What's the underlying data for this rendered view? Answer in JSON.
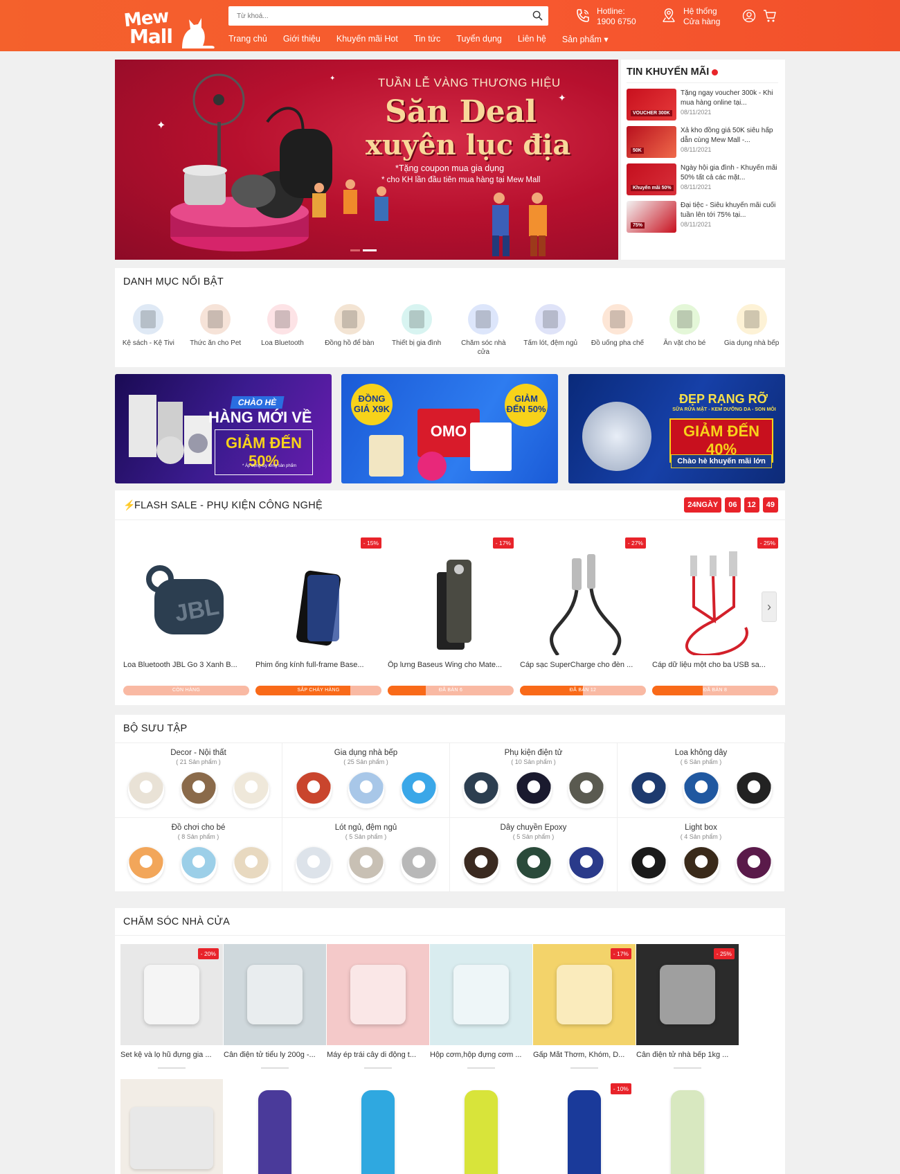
{
  "header": {
    "logo_line1": "Mew",
    "logo_line2": "Mall",
    "search_placeholder": "Từ khoá...",
    "hotline_label": "Hotline:",
    "hotline_number": "1900 6750",
    "store_line1": "Hệ thống",
    "store_line2": "Cửa hàng"
  },
  "nav": [
    "Trang chủ",
    "Giới thiệu",
    "Khuyến mãi Hot",
    "Tin tức",
    "Tuyển dụng",
    "Liên hệ",
    "Sản phẩm ▾"
  ],
  "banner": {
    "line1": "TUẦN LỄ VÀNG THƯƠNG HIỆU",
    "line2": "Săn Deal",
    "line3": "xuyên lục địa",
    "line4": "*Tặng coupon mua gia dụng",
    "line5": "* cho KH lần đầu tiên mua hàng tại Mew Mall"
  },
  "news": {
    "title": "TIN KHUYẾN MÃI",
    "items": [
      {
        "text": "Tặng ngay voucher 300k - Khi mua hàng online tại...",
        "date": "08/11/2021",
        "badge": "VOUCHER 300K"
      },
      {
        "text": "Xả kho đồng giá 50K siêu hấp dẫn cùng Mew Mall -...",
        "date": "08/11/2021",
        "badge": "50K"
      },
      {
        "text": "Ngày hội gia đình - Khuyến mãi 50% tất cả các mặt...",
        "date": "08/11/2021",
        "badge": "Khuyến mãi 50%"
      },
      {
        "text": "Đại tiệc - Siêu khuyến mãi cuối tuần lên tới 75% tại...",
        "date": "08/11/2021",
        "badge": "75%"
      }
    ]
  },
  "categories": {
    "title": "DANH MỤC NỔI BẬT",
    "items": [
      {
        "label": "Kệ sách - Kệ Tivi",
        "color": "#dfe9f5"
      },
      {
        "label": "Thức ăn cho Pet",
        "color": "#f6e3d8"
      },
      {
        "label": "Loa Bluetooth",
        "color": "#fde3e6"
      },
      {
        "label": "Đồng hồ để bàn",
        "color": "#f3e4d3"
      },
      {
        "label": "Thiết bị gia đình",
        "color": "#d8f4f1"
      },
      {
        "label": "Chăm sóc nhà cửa",
        "color": "#dde6fb"
      },
      {
        "label": "Tấm lót, đệm ngủ",
        "color": "#dfe3f8"
      },
      {
        "label": "Đồ uống pha chế",
        "color": "#fde6d6"
      },
      {
        "label": "Ăn vặt cho bé",
        "color": "#e4f7d8"
      },
      {
        "label": "Gia dụng nhà bếp",
        "color": "#fdf2d6"
      }
    ]
  },
  "promos": [
    {
      "line1": "CHÀO HÈ",
      "line2": "HÀNG MỚI VỀ",
      "line3": "GIẢM ĐẾN 50%",
      "note": "* Áp dụng tùy từng sản phẩm"
    },
    {
      "line1": "ĐỒNG GIÁ X9K",
      "line2": "OMO",
      "line3": "GIẢM ĐẾN 50%"
    },
    {
      "line1": "ĐẸP RẠNG RỠ",
      "line2": "SỮA RỬA MẶT - KEM DƯỠNG DA - SON MÔI",
      "line3": "GIẢM ĐẾN 40%",
      "note": "Chào hè khuyến mãi lớn"
    }
  ],
  "flash_sale": {
    "title": "FLASH SALE - PHỤ KIỆN CÔNG NGHỆ",
    "timer": [
      "24NGÀY",
      "06",
      "12",
      "49"
    ],
    "items": [
      {
        "name": "Loa Bluetooth JBL Go 3 Xanh B...",
        "discount": "",
        "bar_label": "CÒN HÀNG",
        "progress": 0,
        "color": "#2c3e50"
      },
      {
        "name": "Phim ống kính full-frame Base...",
        "discount": "- 15%",
        "bar_label": "SẮP CHÁY HÀNG",
        "progress": 0.75,
        "color": "#1a1a2e"
      },
      {
        "name": "Ốp lưng Baseus Wing cho Mate...",
        "discount": "- 17%",
        "bar_label": "ĐÃ BÁN 6",
        "progress": 0.3,
        "color": "#4a4a42"
      },
      {
        "name": "Cáp sạc SuperCharge cho đèn ...",
        "discount": "- 27%",
        "bar_label": "ĐÃ BÁN 12",
        "progress": 0.5,
        "color": "#2b2b2b"
      },
      {
        "name": "Cáp dữ liệu một cho ba USB sa...",
        "discount": "- 25%",
        "bar_label": "ĐÃ BÁN 8",
        "progress": 0.4,
        "color": "#d3202a"
      }
    ]
  },
  "collections": {
    "title": "BỘ SƯU TẬP",
    "items": [
      {
        "name": "Decor - Nội thất",
        "count": "( 21 Sản phẩm )",
        "colors": [
          "#e9e2d6",
          "#8a6a4a",
          "#efe8da"
        ]
      },
      {
        "name": "Gia dụng nhà bếp",
        "count": "( 25 Sản phẩm )",
        "colors": [
          "#c9452d",
          "#a8c7e8",
          "#3aa7e8"
        ]
      },
      {
        "name": "Phụ kiện điện tử",
        "count": "( 10 Sản phẩm )",
        "colors": [
          "#2c3e50",
          "#1a1a2e",
          "#5a5a50"
        ]
      },
      {
        "name": "Loa không dây",
        "count": "( 6 Sản phẩm )",
        "colors": [
          "#1d3a6e",
          "#2058a0",
          "#222222"
        ]
      },
      {
        "name": "Đồ chơi cho bé",
        "count": "( 8 Sản phẩm )",
        "colors": [
          "#f2a65a",
          "#9ccfe8",
          "#e8d9c0"
        ]
      },
      {
        "name": "Lót ngủ, đệm ngủ",
        "count": "( 5 Sản phẩm )",
        "colors": [
          "#dde3ea",
          "#c8c0b4",
          "#b8b8b8"
        ]
      },
      {
        "name": "Dây chuyền Epoxy",
        "count": "( 5 Sản phẩm )",
        "colors": [
          "#3a2a20",
          "#2a4a3a",
          "#2a3a8a"
        ]
      },
      {
        "name": "Light box",
        "count": "( 4 Sản phẩm )",
        "colors": [
          "#1a1a1a",
          "#3a2a1a",
          "#5a1a4a"
        ]
      }
    ]
  },
  "home_care": {
    "title": "CHĂM SÓC NHÀ CỬA",
    "row1": [
      {
        "name": "Set kệ và lọ hũ đựng gia ...",
        "discount": "- 20%",
        "color": "#e8e8e8"
      },
      {
        "name": "Cân điện tử tiểu ly 200g -...",
        "discount": "",
        "color": "#cfd8dc"
      },
      {
        "name": "Máy ép trái cây di động t...",
        "discount": "",
        "color": "#f4c9c9"
      },
      {
        "name": "Hộp cơm,hộp đựng cơm ...",
        "discount": "",
        "color": "#d9ecef"
      },
      {
        "name": "Gấp Mắt Thơm, Khóm, D...",
        "discount": "- 17%",
        "color": "#f3d36a"
      },
      {
        "name": "Cân điện tử nhà bếp 1kg ...",
        "discount": "- 25%",
        "color": "#2b2b2b"
      }
    ],
    "row2": [
      {
        "discount": "",
        "color": "#f2ede6"
      },
      {
        "discount": "",
        "color": "#ffffff"
      },
      {
        "discount": "",
        "color": "#ffffff"
      },
      {
        "discount": "",
        "color": "#ffffff"
      },
      {
        "discount": "- 10%",
        "color": "#ffffff"
      },
      {
        "discount": "",
        "color": "#ffffff"
      }
    ]
  }
}
